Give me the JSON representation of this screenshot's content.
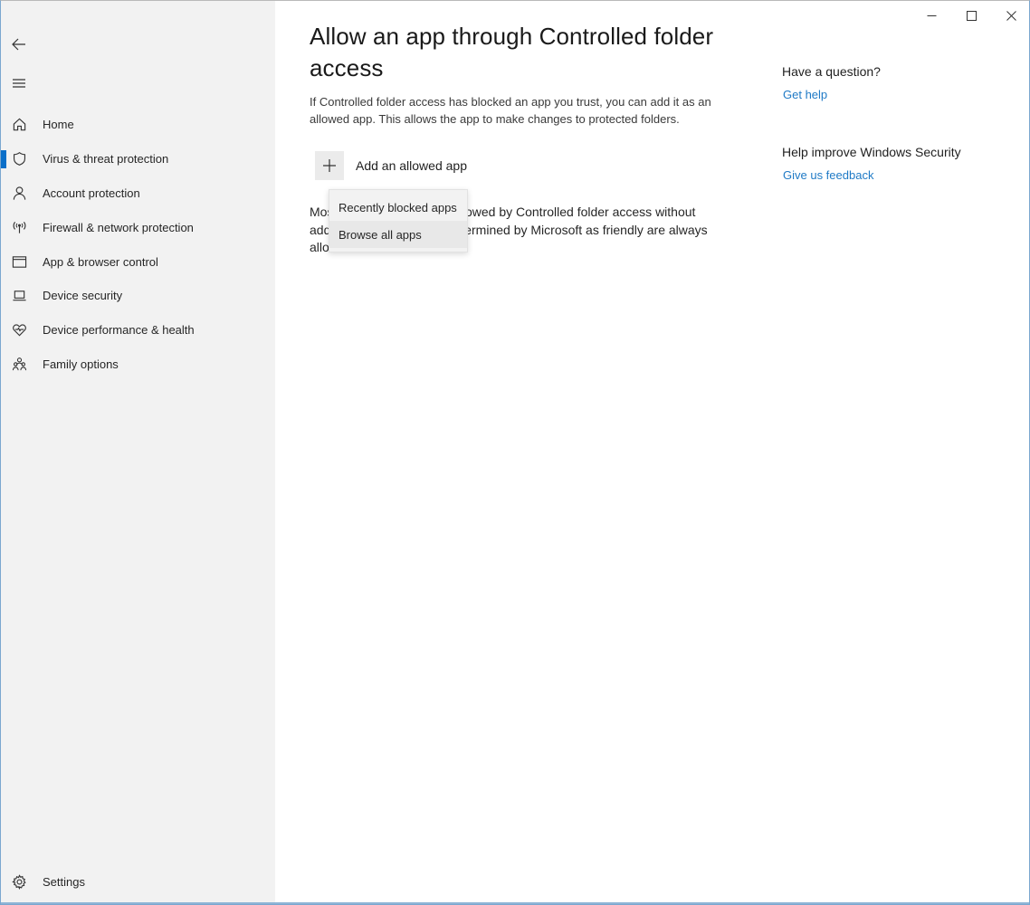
{
  "window": {
    "controls": {
      "minimize": "minimize-icon",
      "maximize": "maximize-icon",
      "close": "close-icon"
    }
  },
  "sidebar": {
    "back_icon": "back-arrow-icon",
    "menu_icon": "hamburger-menu-icon",
    "items": [
      {
        "label": "Home",
        "icon": "home-icon",
        "active": false
      },
      {
        "label": "Virus & threat protection",
        "icon": "shield-icon",
        "active": true
      },
      {
        "label": "Account protection",
        "icon": "person-icon",
        "active": false
      },
      {
        "label": "Firewall & network protection",
        "icon": "wireless-antenna-icon",
        "active": false
      },
      {
        "label": "App & browser control",
        "icon": "browser-window-icon",
        "active": false
      },
      {
        "label": "Device security",
        "icon": "laptop-icon",
        "active": false
      },
      {
        "label": "Device performance & health",
        "icon": "heart-icon",
        "active": false
      },
      {
        "label": "Family options",
        "icon": "family-icon",
        "active": false
      }
    ],
    "settings": {
      "label": "Settings",
      "icon": "gear-icon"
    }
  },
  "main": {
    "title": "Allow an app through Controlled folder access",
    "description": "If Controlled folder access has blocked an app you trust, you can add it as an allowed app. This allows the app to make changes to protected folders.",
    "add_button": {
      "label": "Add an allowed app",
      "icon": "plus-icon"
    },
    "body_text": "Most of your apps will be allowed by Controlled folder access without adding them here. Apps determined by Microsoft as friendly are always allowed.",
    "dropdown": {
      "items": [
        {
          "label": "Recently blocked apps"
        },
        {
          "label": "Browse all apps"
        }
      ]
    }
  },
  "help": {
    "question_heading": "Have a question?",
    "question_link": "Get help",
    "feedback_heading": "Help improve Windows Security",
    "feedback_link": "Give us feedback"
  },
  "colors": {
    "accent": "#0a6fc9",
    "link": "#1f7ac6",
    "sidebar_bg": "#f2f2f2"
  }
}
